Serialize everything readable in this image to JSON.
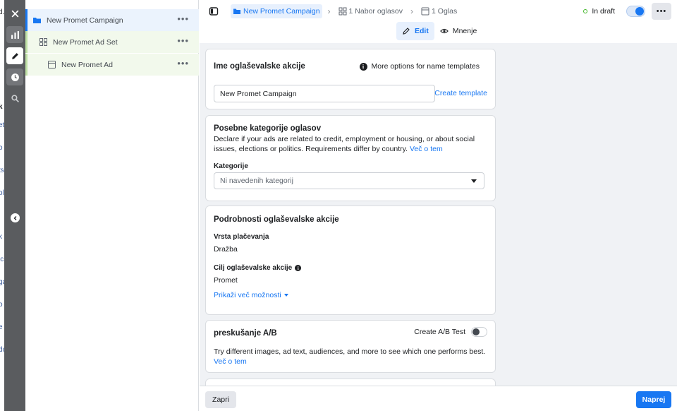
{
  "page_sliver": [
    "d.",
    "k",
    "et",
    "o",
    "ts",
    "ole",
    "k",
    "ic",
    "ga",
    "o",
    "e",
    "do"
  ],
  "rail": {
    "buttons": [
      {
        "icon": "close-icon"
      },
      {
        "icon": "bar-chart-icon"
      },
      {
        "icon": "pencil-icon"
      },
      {
        "icon": "clock-icon"
      },
      {
        "icon": "search-icon"
      }
    ],
    "collapse_icon": "chevron-left-icon"
  },
  "tree": {
    "campaign": "New Promet Campaign",
    "adset": "New Promet Ad Set",
    "ad": "New Promet Ad",
    "more": "•••"
  },
  "breadcrumb": {
    "campaign": "New Promet Campaign",
    "adset": "1 Nabor oglasov",
    "ad": "1 Oglas",
    "separator": "›"
  },
  "status": {
    "label": "In draft",
    "color": "#42b72a"
  },
  "more_button": "•••",
  "modes": {
    "edit": "Edit",
    "review": "Mnenje"
  },
  "campaign_name_card": {
    "title": "Ime oglaševalske akcije",
    "more_options": "More options for name templates",
    "info_glyph": "i",
    "input_value": "New Promet Campaign",
    "create_template": "Create template"
  },
  "special_categories_card": {
    "title": "Posebne kategorije oglasov",
    "description": "Declare if your ads are related to credit, employment or housing, or about social issues, elections or politics. Requirements differ by country.",
    "learn_more": "Več o tem",
    "categories_label": "Kategorije",
    "categories_value": "Ni navedenih kategorij"
  },
  "details_card": {
    "title": "Podrobnosti oglaševalske akcije",
    "buying_type_label": "Vrsta plačevanja",
    "buying_type_value": "Dražba",
    "objective_label": "Cilj oglaševalske akcije",
    "info_glyph": "i",
    "objective_value": "Promet",
    "show_more": "Prikaži več možnosti"
  },
  "ab_test_card": {
    "title": "preskušanje A/B",
    "toggle_label": "Create A/B Test",
    "description": "Try different images, ad text, audiences, and more to see which one performs best.",
    "learn_more": "Več o tem"
  },
  "footer": {
    "close": "Zapri",
    "next": "Naprej"
  },
  "colors": {
    "accent": "#1877f2",
    "rail": "#5a5c5f",
    "canvas": "#f0f2f5"
  }
}
